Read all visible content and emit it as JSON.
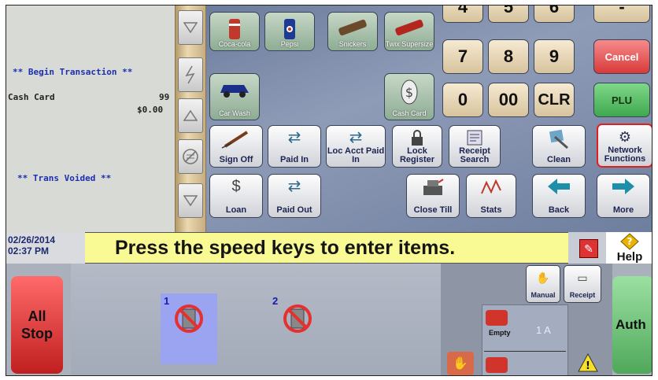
{
  "receipt": {
    "begin": "** Begin Transaction **",
    "item_name": "Cash Card",
    "item_qty": "99",
    "item_amount": "$0.00",
    "voided": "** Trans Voided **"
  },
  "speed_keys": [
    {
      "label": "Coca-cola",
      "icon": "soda-can-icon",
      "color": "#c0392b"
    },
    {
      "label": "Pepsi",
      "icon": "pepsi-can-icon",
      "color": "#1f3a93"
    },
    {
      "label": "Snickers",
      "icon": "candy-bar-icon",
      "color": "#6b4a2b"
    },
    {
      "label": "Twix Supersize",
      "icon": "twix-bar-icon",
      "color": "#b3261e"
    },
    {
      "label": "Car Wash",
      "icon": "car-icon",
      "color": "#1a2e8a"
    },
    {
      "label": "Cash Card",
      "icon": "dollar-card-icon",
      "color": "#444444"
    }
  ],
  "numpad": {
    "top_row": [
      "4",
      "5",
      "6"
    ],
    "row1": [
      "7",
      "8",
      "9"
    ],
    "row2": [
      "0",
      "00",
      "CLR"
    ],
    "top_right": "-"
  },
  "cancel_label": "Cancel",
  "plu_label": "PLU",
  "function_keys": [
    {
      "label": "Sign Off",
      "icon": "pen-icon"
    },
    {
      "label": "Paid In",
      "icon": "paid-in-icon"
    },
    {
      "label": "Loc Acct Paid In",
      "icon": "people-icon"
    },
    {
      "label": "Lock Register",
      "icon": "lock-icon"
    },
    {
      "label": "Receipt Search",
      "icon": "receipt-icon"
    },
    {
      "label": "Clean",
      "icon": "broom-icon"
    },
    {
      "label": "Network Functions",
      "icon": "network-icon"
    },
    {
      "label": "Loan",
      "icon": "money-bag-icon"
    },
    {
      "label": "Paid Out",
      "icon": "paid-out-icon"
    },
    {
      "label": "Close Till",
      "icon": "register-icon"
    },
    {
      "label": "Stats",
      "icon": "chart-icon"
    },
    {
      "label": "Back",
      "icon": "arrow-left-icon"
    },
    {
      "label": "More",
      "icon": "arrow-right-icon"
    }
  ],
  "status": {
    "date": "02/26/2014",
    "time": "02:37 PM",
    "prompt": "Press the speed keys to enter items.",
    "help": "Help"
  },
  "bottom": {
    "all_stop": "All Stop",
    "auth": "Auth",
    "pumps": [
      {
        "number": "1"
      },
      {
        "number": "2"
      }
    ],
    "manual": "Manual",
    "receipt": "Receipt",
    "empty": "Empty",
    "line_label": "1 A"
  },
  "colors": {
    "cancel": "#e74c4c",
    "plu": "#3fa84e",
    "prompt_bg": "#fafa94",
    "highlight": "#e02020"
  }
}
